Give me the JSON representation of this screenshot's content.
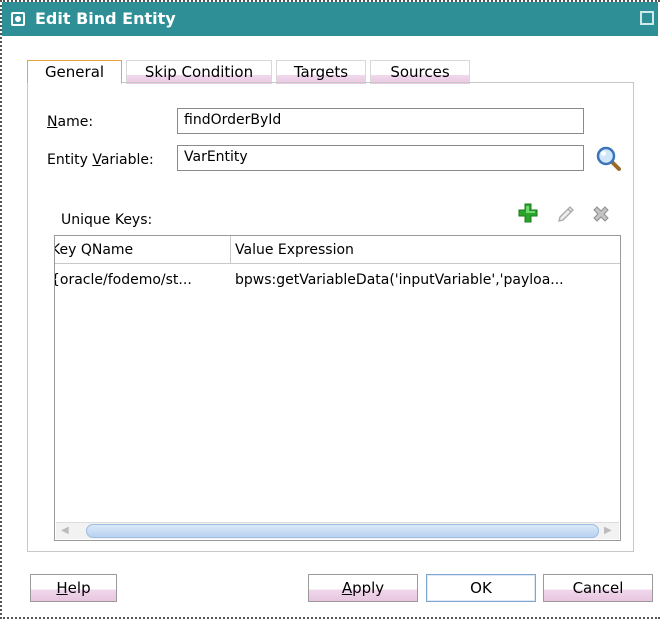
{
  "window": {
    "title": "Edit Bind Entity"
  },
  "tabs": [
    {
      "label": "General",
      "active": true
    },
    {
      "label": "Skip Condition",
      "active": false
    },
    {
      "label": "Targets",
      "active": false
    },
    {
      "label": "Sources",
      "active": false
    }
  ],
  "form": {
    "name_label_mnemonic": "N",
    "name_label_rest": "ame:",
    "name_value": "findOrderById",
    "entity_label_pre": "Entity ",
    "entity_label_mnemonic": "V",
    "entity_label_rest": "ariable:",
    "entity_value": "VarEntity"
  },
  "unique_keys": {
    "label": "Unique Keys:",
    "columns": [
      "Key QName",
      "Value Expression"
    ],
    "rows": [
      {
        "key": "{oracle/fodemo/st...",
        "value": "bpws:getVariableData('inputVariable','payloa..."
      }
    ]
  },
  "icons": {
    "search": "magnifier-icon",
    "add": "plus-icon",
    "edit": "pencil-icon",
    "delete": "x-icon",
    "accent": "#2f8f97",
    "add_color": "#2aa52a"
  },
  "buttons": {
    "help_mnemonic": "H",
    "help_rest": "elp",
    "apply_mnemonic": "A",
    "apply_rest": "pply",
    "ok": "OK",
    "cancel": "Cancel"
  }
}
